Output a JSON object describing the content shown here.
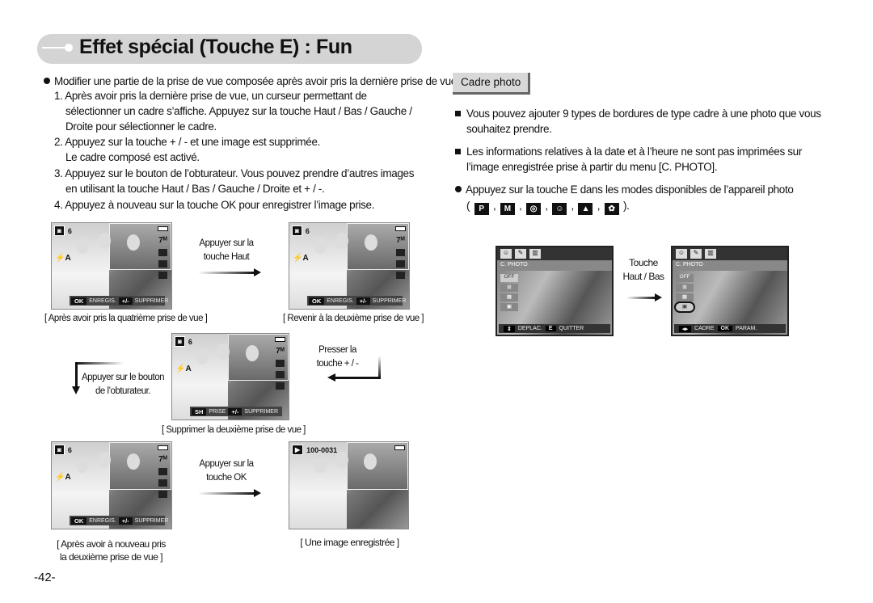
{
  "title": "Effet spécial (Touche E) : Fun",
  "left": {
    "intro": "Modifier une partie de la prise de vue composée après avoir pris la dernière prise de vue.",
    "lines": [
      "1. Après avoir pris la dernière prise de vue, un curseur permettant de",
      "sélectionner un cadre s’affiche. Appuyez sur la touche Haut / Bas / Gauche /",
      "Droite pour sélectionner le cadre.",
      "2. Appuyez sur la touche + / - et une image est supprimée.",
      "Le cadre composé est activé.",
      "3. Appuyez sur le bouton de l’obturateur. Vous pouvez prendre d’autres images",
      "en utilisant la touche Haut / Bas / Gauche / Droite et + / -.",
      "4. Appuyez à nouveau sur la touche OK pour enregistrer l’image prise."
    ],
    "screens": [
      {
        "count": "6",
        "btn1": "OK",
        "lbl1": "ENREGIS.",
        "btn2": "+/-",
        "lbl2": "SUPPRIMER",
        "caption": "[ Après avoir pris la quatrième prise de vue ]"
      },
      {
        "count": "6",
        "btn1": "OK",
        "lbl1": "ENREGIS.",
        "btn2": "+/-",
        "lbl2": "SUPPRIMER",
        "caption": "[ Revenir à la deuxième prise de vue ]"
      },
      {
        "count": "6",
        "btn1": "SH",
        "lbl1": "PRISE",
        "btn2": "+/-",
        "lbl2": "SUPPRIMER",
        "caption": "[ Supprimer la deuxième prise de vue ]"
      },
      {
        "count": "6",
        "btn1": "OK",
        "lbl1": "ENREGIS.",
        "btn2": "+/-",
        "lbl2": "SUPPRIMER",
        "caption": "[ Après avoir à nouveau pris",
        "caption2": "la deuxième prise de vue ]"
      },
      {
        "count": "100-0031",
        "playback": true,
        "caption": "[ Une image enregistrée ]"
      }
    ],
    "arrows": {
      "haut": [
        "Appuyer sur la",
        "touche Haut"
      ],
      "plus": [
        "Presser la",
        "touche + / -"
      ],
      "obturateur": [
        "Appuyer sur le bouton",
        "de l’obturateur."
      ],
      "ok": [
        "Appuyer sur la",
        "touche OK"
      ]
    },
    "page_number": "-42-"
  },
  "right": {
    "section": "Cadre photo",
    "bullets": [
      [
        "Vous pouvez ajouter 9 types de bordures de type cadre à une photo que vous",
        "souhaitez prendre."
      ],
      [
        "Les informations relatives à la date et à l’heure ne sont pas imprimées sur",
        "l’image enregistrée prise à partir du menu [C. PHOTO]."
      ]
    ],
    "modes_line": "Appuyez sur la touche E dans les modes disponibles de l’appareil photo",
    "mode_icons": [
      "program-icon",
      "manual-icon",
      "dis-icon",
      "portrait-icon",
      "landscape-icon",
      "macro-icon"
    ],
    "mode_labels": [
      "P",
      "M",
      "◎",
      "☺",
      "▲",
      "✿"
    ],
    "touche": [
      "Touche",
      "Haut / Bas"
    ],
    "menus": [
      {
        "title": "C. PHOTO",
        "options": [
          "OFF",
          "⊞",
          "▦",
          "▣"
        ],
        "selected": 0,
        "btn1": "⇕",
        "lbl1": "DEPLAC.",
        "btn2": "E",
        "lbl2": "QUITTER"
      },
      {
        "title": "C. PHOTO",
        "options": [
          "OFF",
          "⊞",
          "▦",
          "▣"
        ],
        "selected": 3,
        "btn1": "◂▸",
        "lbl1": "CADRE",
        "btn2": "OK",
        "lbl2": "PARAM."
      }
    ]
  }
}
